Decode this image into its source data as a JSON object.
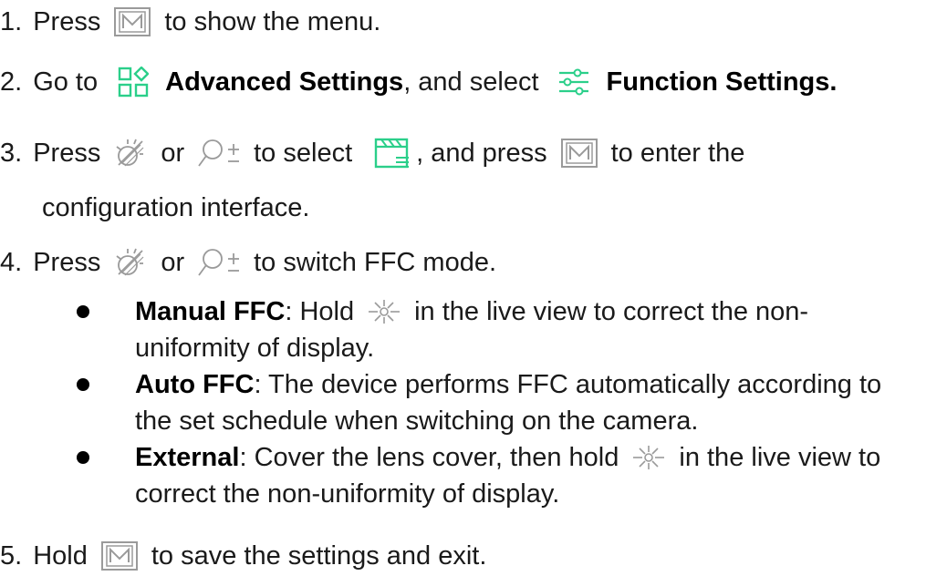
{
  "steps": {
    "s1": {
      "num": "1.",
      "a": "Press",
      "b": "to show the menu."
    },
    "s2": {
      "num": "2.",
      "a": "Go to",
      "b": "Advanced Settings",
      "c": ", and select",
      "d": "Function Settings."
    },
    "s3": {
      "num": "3.",
      "a": "Press",
      "b": "or",
      "c": "to select",
      "d": ", and press",
      "e": "to enter the",
      "f": "configuration interface."
    },
    "s4": {
      "num": "4.",
      "a": "Press",
      "b": "or",
      "c": "to switch FFC mode."
    },
    "s5": {
      "num": "5.",
      "a": "Hold",
      "b": "to save the settings and exit."
    }
  },
  "bullets": [
    {
      "title": "Manual FFC",
      "l1a": ": Hold",
      "l1b": "in the live view to correct the non-",
      "l2": "uniformity of display."
    },
    {
      "title": "Auto FFC",
      "l1": ": The device performs FFC automatically according to",
      "l2": "the set schedule when switching on the camera."
    },
    {
      "title": "External",
      "l1a": ": Cover the lens cover, then hold",
      "l1b": "in the live view to",
      "l2": "correct the non-uniformity of display."
    }
  ],
  "icons": {
    "menu_key": "m-key-icon",
    "advanced": "advanced-settings-icon",
    "function": "function-settings-icon",
    "brightness": "brightness-icon",
    "zoom": "zoom-icon",
    "ffc": "ffc-icon",
    "shutter": "shutter-icon"
  },
  "colors": {
    "accent": "#2bcf8a",
    "text": "#1a1a1a",
    "icon_gray": "#9a9a9a"
  }
}
